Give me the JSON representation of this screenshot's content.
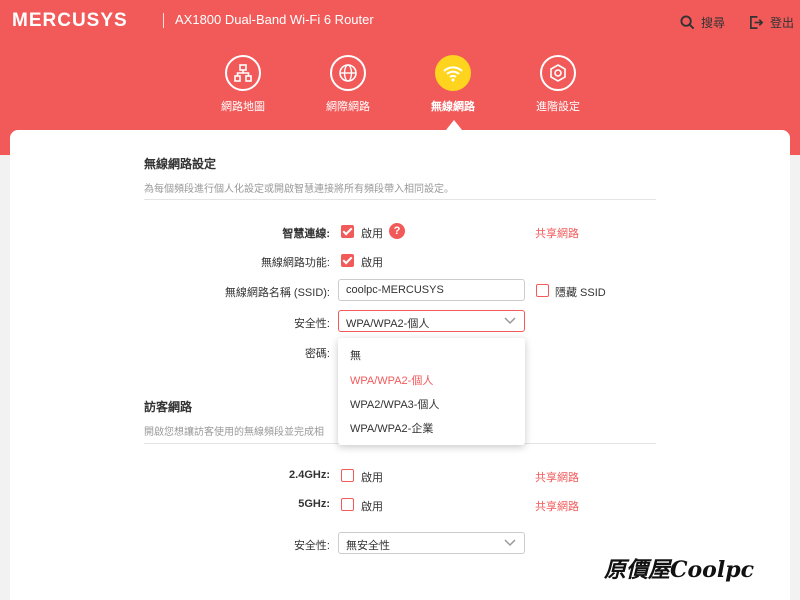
{
  "header": {
    "brand": "MERCUSYS",
    "model": "AX1800 Dual-Band Wi-Fi 6 Router",
    "search_label": "搜尋",
    "logout_label": "登出"
  },
  "nav": [
    {
      "label": "網路地圖",
      "icon": "network-map-icon",
      "active": false
    },
    {
      "label": "網際網路",
      "icon": "globe-icon",
      "active": false
    },
    {
      "label": "無線網路",
      "icon": "wifi-icon",
      "active": true
    },
    {
      "label": "進階設定",
      "icon": "gear-icon",
      "active": false
    }
  ],
  "wireless": {
    "title": "無線網路設定",
    "desc": "為每個頻段進行個人化設定或開啟智慧連接將所有頻段帶入相同設定。",
    "smart_connect_label": "智慧連線:",
    "smart_connect_checked": true,
    "smart_connect_text": "啟用",
    "share_label": "共享網路",
    "wireless_func_label": "無線網路功能:",
    "wireless_func_checked": true,
    "wireless_func_text": "啟用",
    "ssid_label": "無線網路名稱 (SSID):",
    "ssid_value": "coolpc-MERCUSYS",
    "hide_ssid_checked": false,
    "hide_ssid_text": "隱藏 SSID",
    "security_label": "安全性:",
    "security_value": "WPA/WPA2-個人",
    "password_label": "密碼:",
    "security_options": [
      "無",
      "WPA/WPA2-個人",
      "WPA2/WPA3-個人",
      "WPA/WPA2-企業"
    ],
    "selected_option_index": 1
  },
  "guest": {
    "title": "訪客網路",
    "desc": "開啟您想讓訪客使用的無線頻段並完成相",
    "band1_label": "2.4GHz:",
    "band1_checked": false,
    "band1_text": "啟用",
    "band1_share": "共享網路",
    "band2_label": "5GHz:",
    "band2_checked": false,
    "band2_text": "啟用",
    "band2_share": "共享網路",
    "security_label": "安全性:",
    "security_value": "無安全性"
  },
  "watermark": "原價屋Coolpc",
  "colors": {
    "accent": "#f25a5a",
    "active_nav": "#ffd41f"
  }
}
